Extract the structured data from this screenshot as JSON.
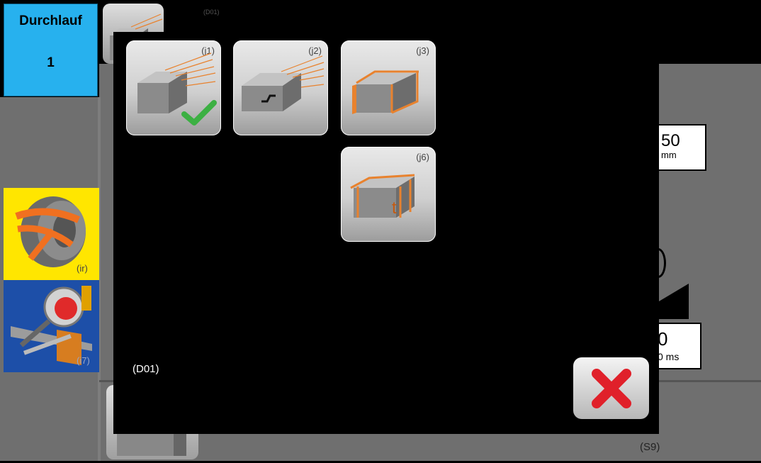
{
  "counter": {
    "label": "Durchlauf",
    "value": "1"
  },
  "top_code": "(D01)",
  "left_tools": [
    {
      "code": "(ir)",
      "icon": "coil-strip-icon",
      "color": "#ffe600"
    },
    {
      "code": "(i7)",
      "icon": "magnifier-inspection-icon",
      "color": "#1d4fa8"
    }
  ],
  "background_values": {
    "value1": "50",
    "unit1": "mm",
    "value2": "0",
    "unit2": "0 ms"
  },
  "status_code": "(S9)",
  "dialog": {
    "code": "(D01)",
    "options": [
      {
        "code": "(j1)",
        "icon": "block-with-strands-icon",
        "selected": true
      },
      {
        "code": "(j2)",
        "icon": "block-with-strands-step-icon",
        "selected": false
      },
      {
        "code": "(j3)",
        "icon": "block-with-bands-icon",
        "selected": false
      },
      {
        "code": "(j6)",
        "icon": "block-with-bands-thickness-icon",
        "selected": false
      }
    ],
    "close_icon": "red-x-icon"
  }
}
